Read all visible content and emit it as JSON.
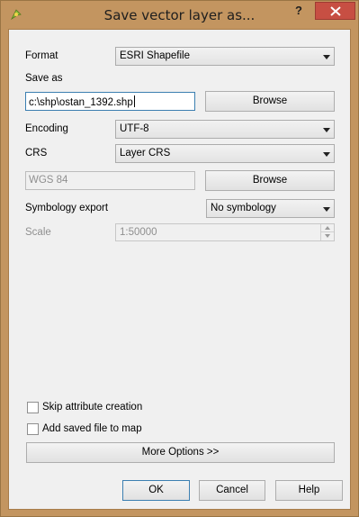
{
  "window": {
    "title": "Save vector layer as...",
    "help_label": "?",
    "close_icon": "close-icon",
    "app_icon": "qgis-icon",
    "accent": "#c74f43"
  },
  "form": {
    "format_label": "Format",
    "format_value": "ESRI Shapefile",
    "save_as_label": "Save as",
    "save_as_value": "c:\\shp\\ostan_1392.shp",
    "browse1_label": "Browse",
    "encoding_label": "Encoding",
    "encoding_value": "UTF-8",
    "crs_label": "CRS",
    "crs_value": "Layer CRS",
    "crs_text": "WGS 84",
    "browse2_label": "Browse",
    "symbology_label": "Symbology export",
    "symbology_value": "No symbology",
    "scale_label": "Scale",
    "scale_value": "1:50000"
  },
  "options": {
    "skip_attr_label": "Skip attribute creation",
    "skip_attr_checked": false,
    "add_map_label": "Add saved file to map",
    "add_map_checked": false,
    "more_options_label": "More Options >>"
  },
  "buttons": {
    "ok": "OK",
    "cancel": "Cancel",
    "help": "Help"
  }
}
